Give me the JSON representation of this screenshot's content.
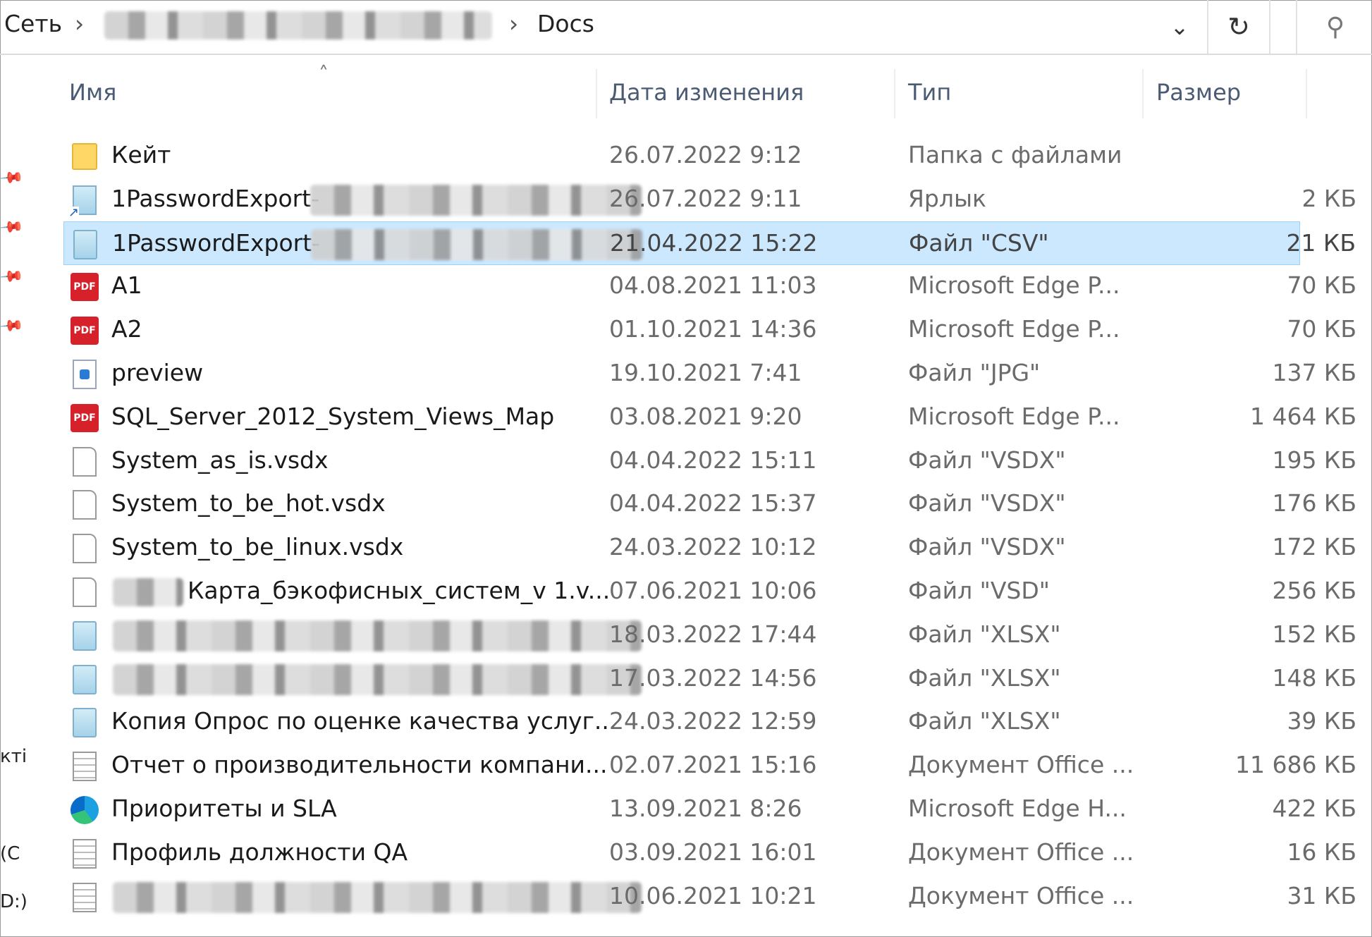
{
  "address": {
    "root": "Сеть",
    "separator": "›",
    "current": "Docs",
    "dropdown_glyph": "⌄",
    "refresh_glyph": "↻",
    "search_glyph": "⚲"
  },
  "columns": {
    "name": "Имя",
    "date": "Дата изменения",
    "type": "Тип",
    "size": "Размер"
  },
  "nav_fragments": [
    "кті",
    "(C",
    "D:)"
  ],
  "files": [
    {
      "name": "Кейт",
      "date": "26.07.2022 9:12",
      "type": "Папка с файлами",
      "size": "",
      "icon": "folder"
    },
    {
      "name": "1PasswordExport-",
      "date": "26.07.2022 9:11",
      "type": "Ярлык",
      "size": "2 КБ",
      "icon": "shortcut",
      "blurred": true
    },
    {
      "name": "1PasswordExport-",
      "date": "21.04.2022 15:22",
      "type": "Файл \"CSV\"",
      "size": "21 КБ",
      "icon": "sheet",
      "blurred": true,
      "selected": true
    },
    {
      "name": "A1",
      "date": "04.08.2021 11:03",
      "type": "Microsoft Edge P...",
      "size": "70 КБ",
      "icon": "pdf"
    },
    {
      "name": "A2",
      "date": "01.10.2021 14:36",
      "type": "Microsoft Edge P...",
      "size": "70 КБ",
      "icon": "pdf"
    },
    {
      "name": "preview",
      "date": "19.10.2021 7:41",
      "type": "Файл \"JPG\"",
      "size": "137 КБ",
      "icon": "jpg"
    },
    {
      "name": "SQL_Server_2012_System_Views_Map",
      "date": "03.08.2021 9:20",
      "type": "Microsoft Edge P...",
      "size": "1 464 КБ",
      "icon": "pdf"
    },
    {
      "name": "System_as_is.vsdx",
      "date": "04.04.2022 15:11",
      "type": "Файл \"VSDX\"",
      "size": "195 КБ",
      "icon": "doc"
    },
    {
      "name": "System_to_be_hot.vsdx",
      "date": "04.04.2022 15:37",
      "type": "Файл \"VSDX\"",
      "size": "176 КБ",
      "icon": "doc"
    },
    {
      "name": "System_to_be_linux.vsdx",
      "date": "24.03.2022 10:12",
      "type": "Файл \"VSDX\"",
      "size": "172 КБ",
      "icon": "doc"
    },
    {
      "name": "Карта_бэкофисных_систем_v 1.v...",
      "date": "07.06.2021 10:06",
      "type": "Файл \"VSD\"",
      "size": "256 КБ",
      "icon": "doc",
      "blurred_prefix": true
    },
    {
      "name": "",
      "date": "18.03.2022 17:44",
      "type": "Файл \"XLSX\"",
      "size": "152 КБ",
      "icon": "sheet",
      "blurred": true
    },
    {
      "name": "",
      "date": "17.03.2022 14:56",
      "type": "Файл \"XLSX\"",
      "size": "148 КБ",
      "icon": "sheet",
      "blurred": true
    },
    {
      "name": "Копия Опрос по оценке качества услуг...",
      "date": "24.03.2022 12:59",
      "type": "Файл \"XLSX\"",
      "size": "39 КБ",
      "icon": "sheet"
    },
    {
      "name": "Отчет о производительности компани...",
      "date": "02.07.2021 15:16",
      "type": "Документ Office ...",
      "size": "11 686 КБ",
      "icon": "doclines"
    },
    {
      "name": "Приоритеты и SLA",
      "date": "13.09.2021 8:26",
      "type": "Microsoft Edge H...",
      "size": "422 КБ",
      "icon": "edge"
    },
    {
      "name": "Профиль должности QA",
      "date": "03.09.2021 16:01",
      "type": "Документ Office ...",
      "size": "16 КБ",
      "icon": "doclines"
    },
    {
      "name": "",
      "date": "10.06.2021 10:21",
      "type": "Документ Office ...",
      "size": "31 КБ",
      "icon": "doclines",
      "blurred": true
    }
  ]
}
